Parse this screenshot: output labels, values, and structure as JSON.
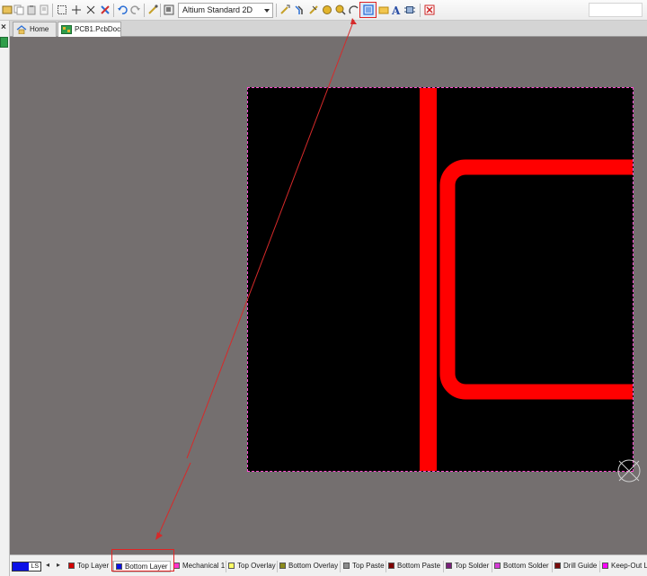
{
  "toolbar": {
    "view_mode": "Altium Standard 2D",
    "icons": [
      "open-icon",
      "copy-icon",
      "paste-icon",
      "select-rect-icon",
      "move-icon",
      "cross-select-icon",
      "deselect-icon",
      "undo-icon",
      "redo-icon",
      "jump-icon",
      "board-insight-icon",
      "interactive-route-icon",
      "diff-pair-route-icon",
      "place-via-icon",
      "place-pad-icon",
      "place-arc-icon",
      "place-region-icon",
      "place-fill-icon",
      "place-string-icon",
      "place-component-icon",
      "drc-clear-icon"
    ],
    "colors": {
      "highlight": "#e02424",
      "accent": "#2b6fd6"
    }
  },
  "left_strip": {
    "close_glyph": "×"
  },
  "tabs": [
    {
      "label": "Home",
      "icon": "home-icon"
    },
    {
      "label": "PCB1.PcbDoc *",
      "icon": "pcb-doc-icon",
      "active": true
    }
  ],
  "canvas": {
    "background": "#746f6f",
    "board_color": "#000000",
    "trace_color": "#ff0000",
    "outline_color": "#ff4dd2"
  },
  "layer_bar": {
    "current_layer_code": "LS",
    "current_layer_color": "#0b10e6",
    "layers": [
      {
        "label": "Top Layer",
        "color": "#d40000"
      },
      {
        "label": "Bottom Layer",
        "color": "#0b10e6",
        "active": true
      },
      {
        "label": "Mechanical 1",
        "color": "#ff33cc"
      },
      {
        "label": "Top Overlay",
        "color": "#ffff66"
      },
      {
        "label": "Bottom Overlay",
        "color": "#8a8a1a"
      },
      {
        "label": "Top Paste",
        "color": "#8c8c8c"
      },
      {
        "label": "Bottom Paste",
        "color": "#800000"
      },
      {
        "label": "Top Solder",
        "color": "#7a1f7a"
      },
      {
        "label": "Bottom Solder",
        "color": "#d63ad6"
      },
      {
        "label": "Drill Guide",
        "color": "#7a0a0a"
      },
      {
        "label": "Keep-Out L",
        "color": "#ff00ff"
      }
    ]
  }
}
